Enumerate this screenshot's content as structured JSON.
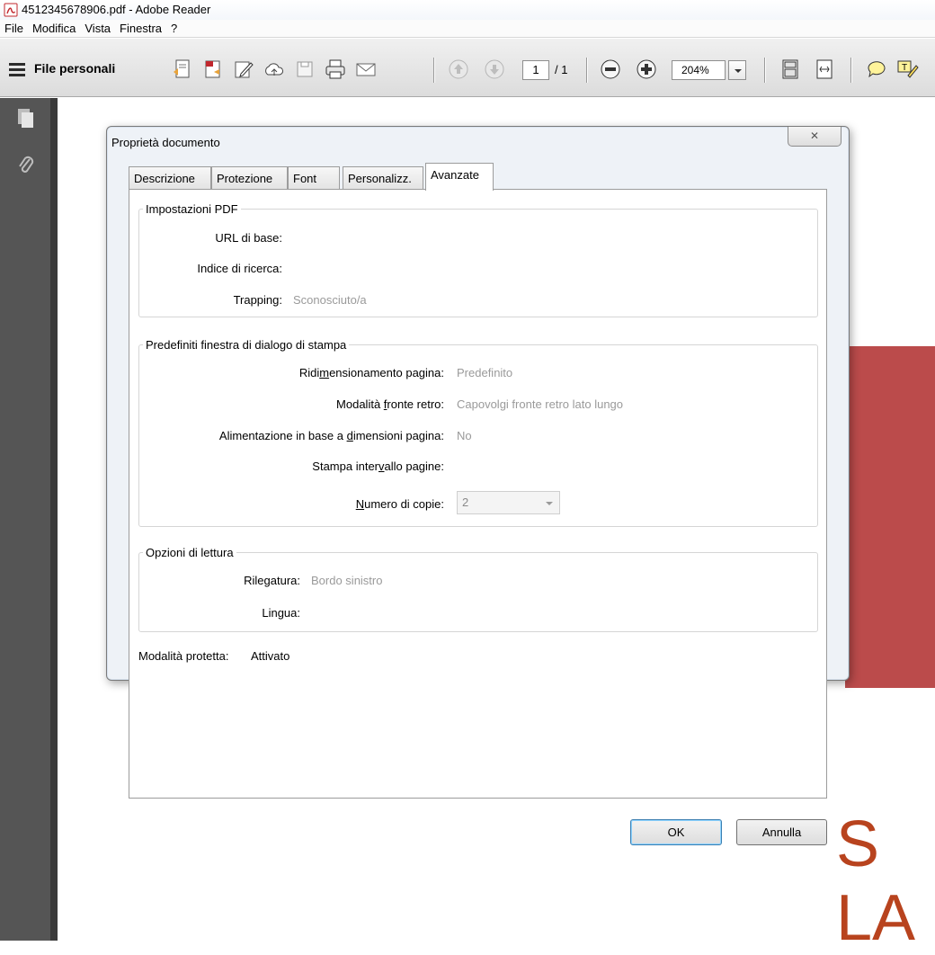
{
  "window": {
    "title": "4512345678906.pdf - Adobe Reader"
  },
  "menu": [
    "File",
    "Modifica",
    "Vista",
    "Finestra",
    "?"
  ],
  "toolbar": {
    "files_label": "File personali",
    "page_current": "1",
    "page_total": "/ 1",
    "zoom": "204%"
  },
  "dialog": {
    "title": "Proprietà documento",
    "close_glyph": "✕",
    "tabs": [
      "Descrizione",
      "Protezione",
      "Font",
      "Personalizz.",
      "Avanzate"
    ],
    "active_tab": "Avanzate",
    "pdf_settings": {
      "legend": "Impostazioni PDF",
      "base_url_label": "URL di base:",
      "base_url_value": "",
      "search_index_label": "Indice di ricerca:",
      "search_index_value": "",
      "trapping_label": "Trapping:",
      "trapping_value": "Sconosciuto/a"
    },
    "print_presets": {
      "legend": "Predefiniti finestra di dialogo di stampa",
      "scaling_label_a": "Ridi",
      "scaling_label_u": "m",
      "scaling_label_b": "ensionamento pagina:",
      "scaling_value": "Predefinito",
      "duplex_label_a": "Modalità ",
      "duplex_label_u": "f",
      "duplex_label_b": "ronte retro:",
      "duplex_value": "Capovolgi fronte retro lato lungo",
      "paper_label_a": "Alimentazione in base a ",
      "paper_label_u": "d",
      "paper_label_b": "imensioni pagina:",
      "paper_value": "No",
      "range_label_a": "Stampa inter",
      "range_label_u": "v",
      "range_label_b": "allo pagine:",
      "range_value": "",
      "copies_label_u": "N",
      "copies_label_b": "umero di copie:",
      "copies_value": "2"
    },
    "reading": {
      "legend": "Opzioni di lettura",
      "binding_label": "Rilegatura:",
      "binding_value": "Bordo sinistro",
      "language_label": "Lingua:",
      "language_value": ""
    },
    "protected_mode_label": "Modalità protetta:",
    "protected_mode_value": "Attivato",
    "ok_label": "OK",
    "cancel_label": "Annulla"
  },
  "document": {
    "visible_text_fragment": "S LA"
  },
  "colors": {
    "accent_red": "#bb4b4b",
    "rail": "#555555"
  }
}
